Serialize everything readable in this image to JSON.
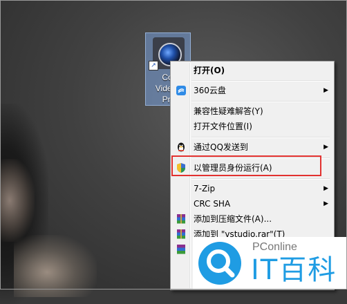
{
  "desktop_icon": {
    "label": "Cor\nVideoS\nPro",
    "icon": "camera-lens-icon"
  },
  "context_menu": {
    "items": [
      {
        "label": "打开(O)",
        "bold": true,
        "icon": "",
        "submenu": false
      },
      {
        "label": "360云盘",
        "icon": "cloud-disk-icon",
        "submenu": true
      },
      {
        "label": "兼容性疑难解答(Y)",
        "icon": "",
        "submenu": false
      },
      {
        "label": "打开文件位置(I)",
        "icon": "",
        "submenu": false
      },
      {
        "label": "通过QQ发送到",
        "icon": "qq-penguin-icon",
        "submenu": true
      },
      {
        "label": "以管理员身份运行(A)",
        "icon": "shield-uac-icon",
        "submenu": false
      },
      {
        "label": "7-Zip",
        "icon": "",
        "submenu": true
      },
      {
        "label": "CRC SHA",
        "icon": "",
        "submenu": true
      },
      {
        "label": "添加到压缩文件(A)...",
        "icon": "winrar-icon",
        "submenu": false
      },
      {
        "label": "添加到 \"vstudio.rar\"(T)",
        "icon": "winrar-icon",
        "submenu": false
      }
    ]
  },
  "watermark": {
    "brand_small": "PConline",
    "brand_big": "IT百科",
    "color": "#1f9ce3"
  }
}
